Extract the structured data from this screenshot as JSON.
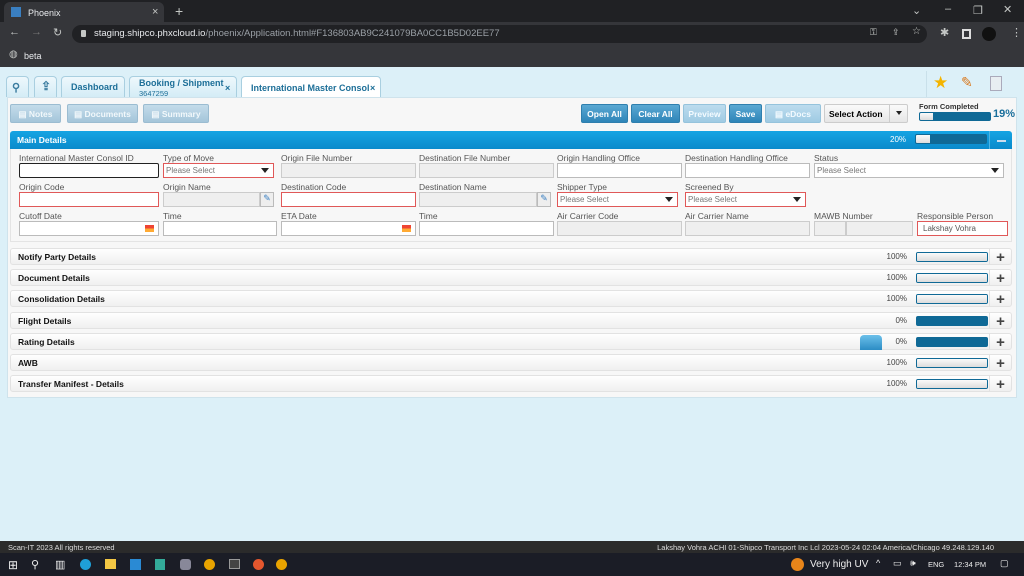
{
  "browser": {
    "tab_title": "Phoenix",
    "url_host": "staging.shipco.phxcloud.io",
    "url_path": "/phoenix/Application.html#F136803AB9C241079BA0CC1B5D02EE77",
    "bookmark": "beta"
  },
  "app_tabs": [
    {
      "label": "Dashboard"
    },
    {
      "label": "Booking / Shipment",
      "sub": "3647259"
    },
    {
      "label": "International Master Consol"
    }
  ],
  "toolbar": {
    "notes": "Notes",
    "documents": "Documents",
    "summary": "Summary",
    "open_all": "Open All",
    "clear_all": "Clear All",
    "preview": "Preview",
    "save": "Save",
    "edocs": "eDocs",
    "select_action": "Select Action",
    "form_completed_label": "Form Completed",
    "form_completed_value": "19%",
    "form_completed_pct": 19
  },
  "main": {
    "title": "Main Details",
    "pct": "20%",
    "pct_value": 20,
    "fields": {
      "consol_id": "International Master Consol ID",
      "type_of_move": "Type of Move",
      "origin_file": "Origin File Number",
      "dest_file": "Destination File Number",
      "origin_office": "Origin Handling Office",
      "dest_office": "Destination Handling Office",
      "status": "Status",
      "origin_code": "Origin Code",
      "origin_name": "Origin Name",
      "dest_code": "Destination Code",
      "dest_name": "Destination Name",
      "shipper_type": "Shipper Type",
      "screened_by": "Screened By",
      "cutoff_date": "Cutoff Date",
      "time1": "Time",
      "eta_date": "ETA Date",
      "time2": "Time",
      "air_code": "Air Carrier Code",
      "air_name": "Air Carrier Name",
      "mawb": "MAWB Number",
      "responsible": "Responsible Person"
    },
    "placeholder": "Please Select",
    "responsible_value": "Lakshay Vohra"
  },
  "sections": [
    {
      "title": "Notify Party Details",
      "pct": "100%",
      "value": 100
    },
    {
      "title": "Document Details",
      "pct": "100%",
      "value": 100
    },
    {
      "title": "Consolidation Details",
      "pct": "100%",
      "value": 100
    },
    {
      "title": "Flight Details",
      "pct": "0%",
      "value": 0
    },
    {
      "title": "Rating Details",
      "pct": "0%",
      "value": 0
    },
    {
      "title": "AWB",
      "pct": "100%",
      "value": 100
    },
    {
      "title": "Transfer Manifest - Details",
      "pct": "100%",
      "value": 100
    }
  ],
  "footer": {
    "left": "Scan-IT 2023 All rights reserved",
    "right": "Lakshay Vohra ACHI 01-Shipco Transport Inc Lcl 2023-05-24 02:04 America/Chicago 49.248.129.140"
  },
  "taskbar": {
    "weather": "Very high UV",
    "lang": "ENG",
    "time": "12:34 PM"
  }
}
